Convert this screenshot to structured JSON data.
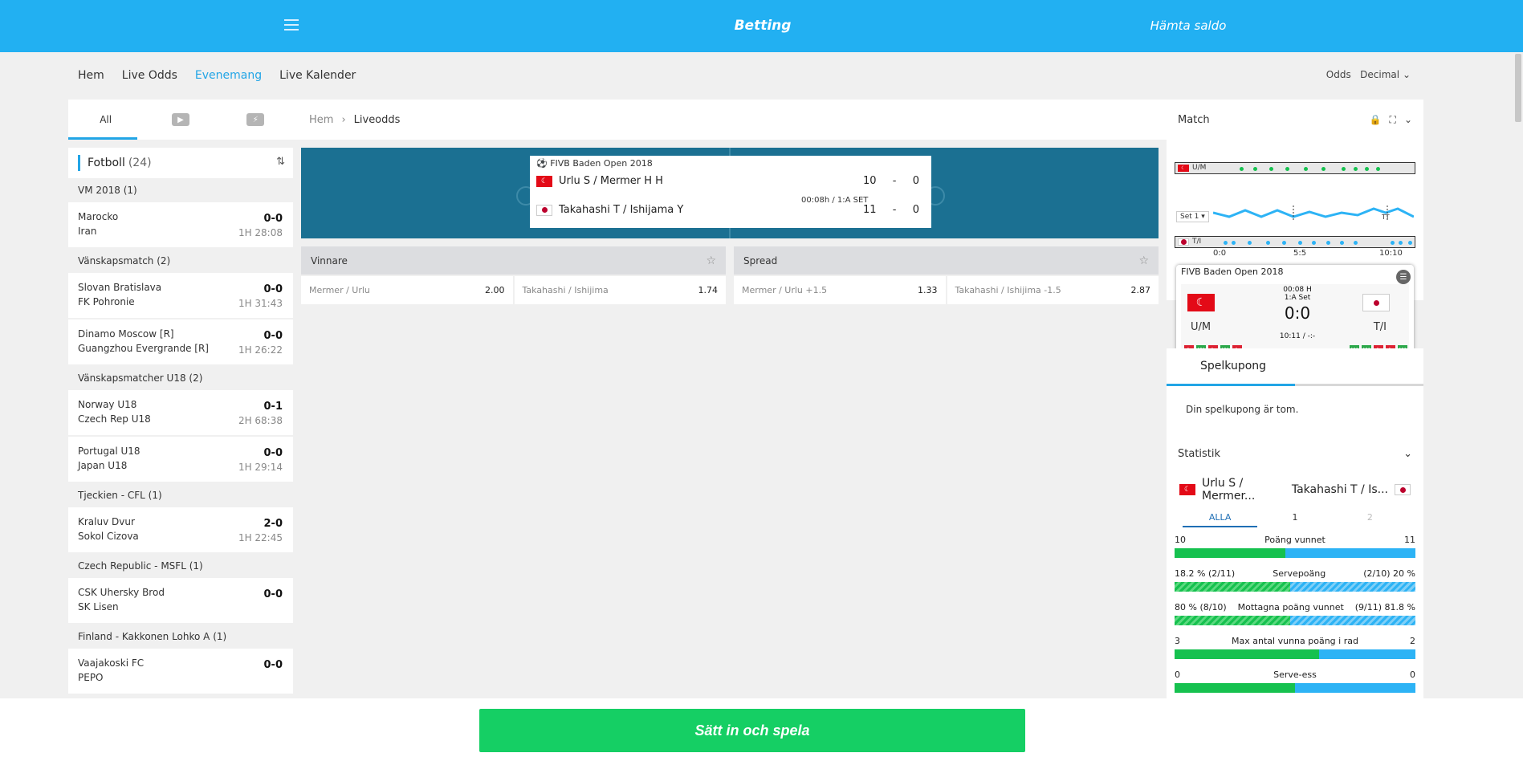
{
  "topbar": {
    "title": "Betting",
    "balance": "Hämta saldo"
  },
  "nav": {
    "items": [
      "Hem",
      "Live Odds",
      "Evenemang",
      "Live Kalender"
    ],
    "active": "Evenemang"
  },
  "odds_format": {
    "label": "Odds",
    "value": "Decimal"
  },
  "left": {
    "tabs": {
      "all": "All"
    },
    "sport": {
      "name": "Fotboll",
      "count": "(24)"
    },
    "groups": [
      {
        "league": "VM 2018  (1)",
        "matches": [
          {
            "home": "Marocko",
            "away": "Iran",
            "score": "0-0",
            "time": "1H 28:08"
          }
        ]
      },
      {
        "league": "Vänskapsmatch  (2)",
        "matches": [
          {
            "home": "Slovan Bratislava",
            "away": "FK Pohronie",
            "score": "0-0",
            "time": "1H 31:43"
          },
          {
            "home": "Dinamo Moscow [R]",
            "away": "Guangzhou Evergrande [R]",
            "score": "0-0",
            "time": "1H 26:22"
          }
        ]
      },
      {
        "league": "Vänskapsmatcher U18  (2)",
        "matches": [
          {
            "home": "Norway U18",
            "away": "Czech Rep U18",
            "score": "0-1",
            "time": "2H 68:38"
          },
          {
            "home": "Portugal U18",
            "away": "Japan U18",
            "score": "0-0",
            "time": "1H 29:14"
          }
        ]
      },
      {
        "league": "Tjeckien - CFL  (1)",
        "matches": [
          {
            "home": "Kraluv Dvur",
            "away": "Sokol Cizova",
            "score": "2-0",
            "time": "1H 22:45"
          }
        ]
      },
      {
        "league": "Czech Republic - MSFL  (1)",
        "matches": [
          {
            "home": "CSK Uhersky Brod",
            "away": "SK Lisen",
            "score": "0-0",
            "time": ""
          }
        ]
      },
      {
        "league": "Finland - Kakkonen Lohko A  (1)",
        "matches": [
          {
            "home": "Vaajakoski FC",
            "away": "PEPO",
            "score": "0-0",
            "time": ""
          }
        ]
      }
    ]
  },
  "center": {
    "breadcrumb": {
      "home": "Hem",
      "current": "Liveodds"
    },
    "scoreboard": {
      "competition": "FIVB Baden Open 2018",
      "team1": "Urlu S / Mermer H H",
      "team1_set": "10",
      "team1_pts": "0",
      "team2": "Takahashi T / Ishijama Y",
      "team2_set": "11",
      "team2_pts": "0",
      "sep": "-",
      "clock": "00:08h  /  1:A SET"
    },
    "markets": [
      {
        "title": "Vinnare",
        "selections": [
          {
            "label": "Mermer / Urlu",
            "odds": "2.00"
          },
          {
            "label": "Takahashi / Ishijima",
            "odds": "1.74"
          }
        ]
      },
      {
        "title": "Spread",
        "selections": [
          {
            "label": "Mermer / Urlu  +1.5",
            "odds": "1.33"
          },
          {
            "label": "Takahashi / Ishijima  -1.5",
            "odds": "2.87"
          }
        ]
      }
    ]
  },
  "right": {
    "match_title": "Match",
    "tracker": {
      "team1_abbr": "U/M",
      "team2_abbr": "T/I",
      "set_label": "Set 1",
      "axis": [
        "0:0",
        "5:5",
        "10:10"
      ],
      "end_label": "TT"
    },
    "mini": {
      "competition": "FIVB Baden Open 2018",
      "time": "00:08 H",
      "set": "1:A Set",
      "score": "0:0",
      "bottom": "10:11 / -:-",
      "team1": "U/M",
      "team2": "T/I",
      "form1": [
        "L",
        "W",
        "L",
        "W",
        "L"
      ],
      "form2": [
        "W",
        "W",
        "L",
        "L",
        "W"
      ]
    },
    "coupon": {
      "tab": "Spelkupong",
      "empty": "Din spelkupong är tom."
    },
    "stats": {
      "title": "Statistik",
      "team1": "Urlu S / Mermer...",
      "team2": "Takahashi T / Is...",
      "tabs": [
        "ALLA",
        "1",
        "2"
      ],
      "rows": [
        {
          "left": "10",
          "label": "Poäng vunnet",
          "right": "11",
          "left_share": 0.46,
          "hatched": false
        },
        {
          "left": "18.2 % (2/11)",
          "label": "Servepoäng",
          "right": "(2/10) 20 %",
          "left_share": 0.48,
          "hatched": true
        },
        {
          "left": "80 % (8/10)",
          "label": "Mottagna poäng vunnet",
          "right": "(9/11) 81.8 %",
          "left_share": 0.48,
          "hatched": true
        },
        {
          "left": "3",
          "label": "Max antal vunna poäng i rad",
          "right": "2",
          "left_share": 0.6,
          "hatched": false
        },
        {
          "left": "0",
          "label": "Serve-ess",
          "right": "0",
          "left_share": 0.5,
          "hatched": false
        }
      ]
    }
  },
  "footer": {
    "cta": "Sätt in och spela"
  }
}
